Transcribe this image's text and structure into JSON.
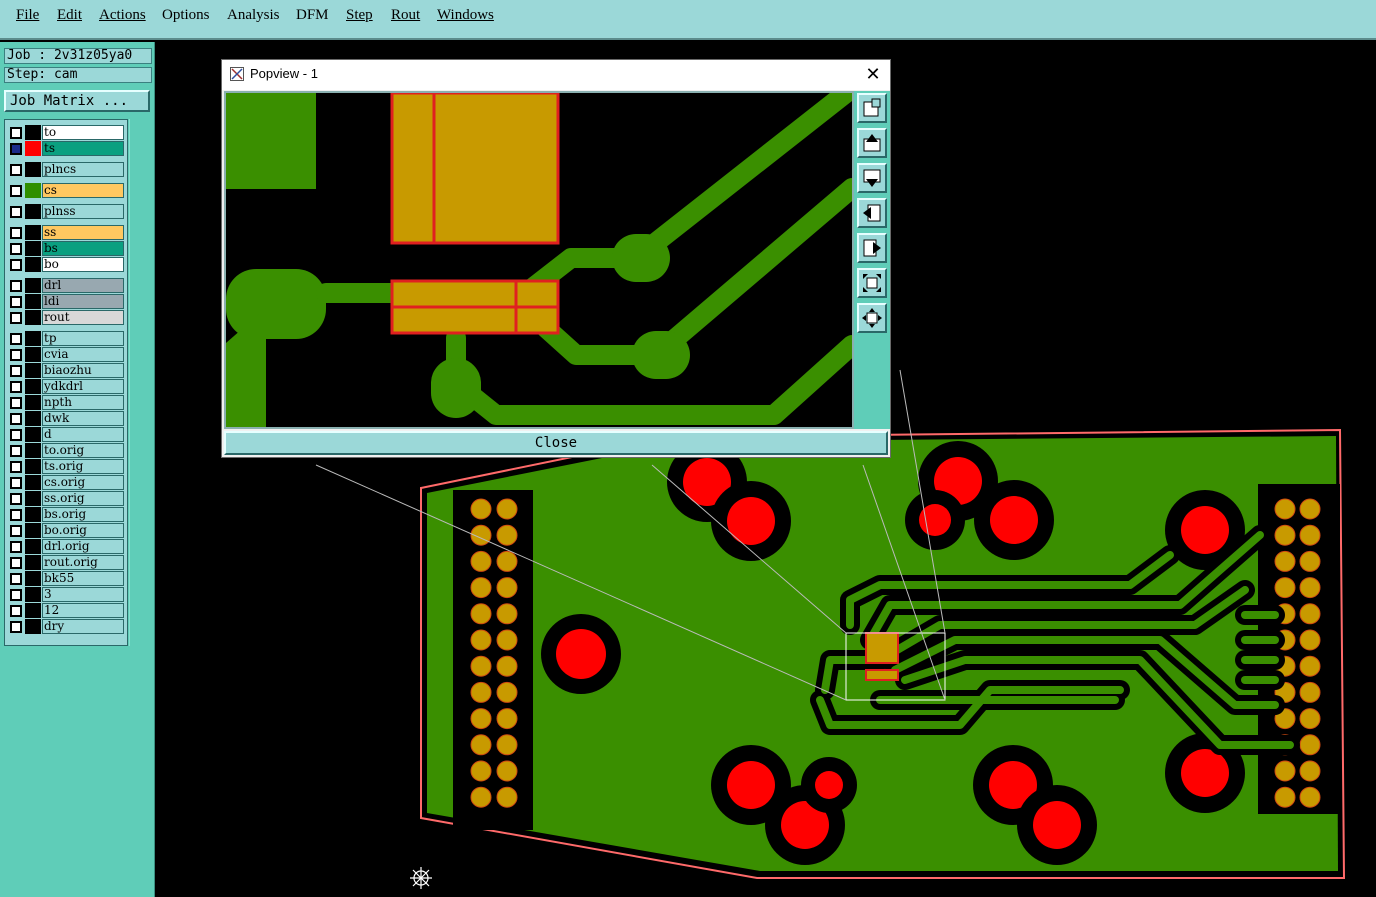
{
  "menu": [
    "File",
    "Edit",
    "Actions",
    "Options",
    "Analysis",
    "DFM",
    "Step",
    "Rout",
    "Windows"
  ],
  "info": {
    "job": "Job : 2v31z05ya0",
    "step": "Step: cam",
    "job_matrix": "Job Matrix ..."
  },
  "layers": [
    {
      "name": "to",
      "color": "#ffffff",
      "swatch": "#000000"
    },
    {
      "name": "ts",
      "color": "#0aa080",
      "swatch": "#ff0000"
    },
    {
      "name": "plncs",
      "color": "#9bd8d8",
      "swatch": "#000000"
    },
    {
      "name": "cs",
      "color": "#ffc860",
      "swatch": "#2f8f00"
    },
    {
      "name": "plnss",
      "color": "#9bd8d8",
      "swatch": "#000000"
    },
    {
      "name": "ss",
      "color": "#ffc860",
      "swatch": "#000000"
    },
    {
      "name": "bs",
      "color": "#0aa080",
      "swatch": "#000000"
    },
    {
      "name": "bo",
      "color": "#ffffff",
      "swatch": "#000000"
    },
    {
      "name": "drl",
      "color": "#98a8b0",
      "swatch": "#000000"
    },
    {
      "name": "ldi",
      "color": "#98a8b0",
      "swatch": "#000000"
    },
    {
      "name": "rout",
      "color": "#d8d8d8",
      "swatch": "#000000"
    },
    {
      "name": "tp",
      "color": "#9bd8d8",
      "swatch": "#000000"
    },
    {
      "name": "cvia",
      "color": "#9bd8d8",
      "swatch": "#000000"
    },
    {
      "name": "biaozhu",
      "color": "#9bd8d8",
      "swatch": "#000000"
    },
    {
      "name": "ydkdrl",
      "color": "#9bd8d8",
      "swatch": "#000000"
    },
    {
      "name": "npth",
      "color": "#9bd8d8",
      "swatch": "#000000"
    },
    {
      "name": "dwk",
      "color": "#9bd8d8",
      "swatch": "#000000"
    },
    {
      "name": "d",
      "color": "#9bd8d8",
      "swatch": "#000000"
    },
    {
      "name": "to.orig",
      "color": "#9bd8d8",
      "swatch": "#000000"
    },
    {
      "name": "ts.orig",
      "color": "#9bd8d8",
      "swatch": "#000000"
    },
    {
      "name": "cs.orig",
      "color": "#9bd8d8",
      "swatch": "#000000"
    },
    {
      "name": "ss.orig",
      "color": "#9bd8d8",
      "swatch": "#000000"
    },
    {
      "name": "bs.orig",
      "color": "#9bd8d8",
      "swatch": "#000000"
    },
    {
      "name": "bo.orig",
      "color": "#9bd8d8",
      "swatch": "#000000"
    },
    {
      "name": "drl.orig",
      "color": "#9bd8d8",
      "swatch": "#000000"
    },
    {
      "name": "rout.orig",
      "color": "#9bd8d8",
      "swatch": "#000000"
    },
    {
      "name": "bk55",
      "color": "#9bd8d8",
      "swatch": "#000000"
    },
    {
      "name": "3",
      "color": "#9bd8d8",
      "swatch": "#000000"
    },
    {
      "name": "12",
      "color": "#9bd8d8",
      "swatch": "#000000"
    },
    {
      "name": "dry",
      "color": "#9bd8d8",
      "swatch": "#000000"
    }
  ],
  "popview": {
    "title": "Popview - 1",
    "close_label": "Close",
    "close_glyph": "✕"
  },
  "toolbar_icons": [
    "zoom-fit-icon",
    "pan-up-icon",
    "pan-down-icon",
    "pan-left-icon",
    "pan-right-icon",
    "zoom-out-icon",
    "zoom-in-icon"
  ],
  "colors": {
    "menubar": "#9bd8d8",
    "panel": "#5fcdb8",
    "copper": "#3a8f00",
    "pad": "#c89a00",
    "hole": "#ff0000",
    "outline": "#ff6666"
  }
}
